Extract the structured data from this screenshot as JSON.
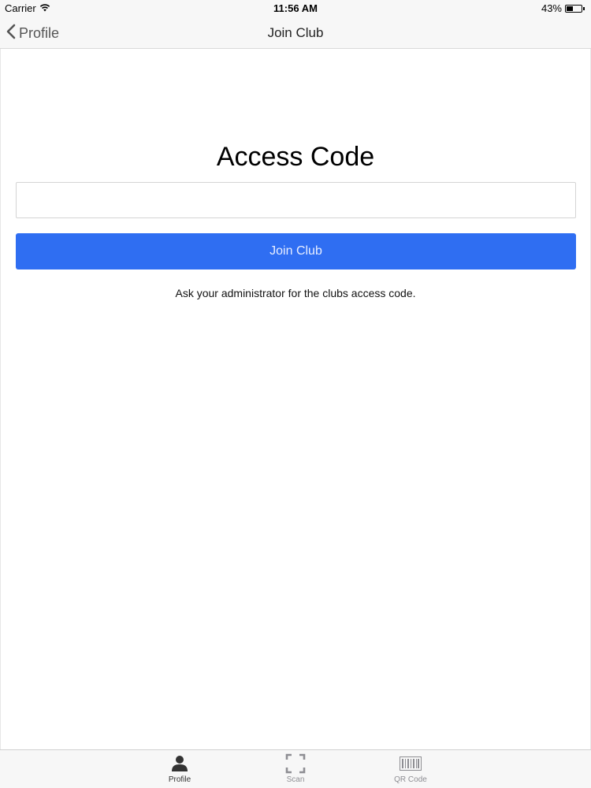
{
  "status_bar": {
    "carrier": "Carrier",
    "time": "11:56 AM",
    "battery_percent_label": "43%",
    "battery_level": 0.43
  },
  "nav": {
    "back_label": "Profile",
    "title": "Join Club"
  },
  "form": {
    "heading": "Access Code",
    "access_code_value": "",
    "access_code_placeholder": "",
    "join_button_label": "Join Club",
    "hint": "Ask your administrator for the clubs access code."
  },
  "tab_bar": {
    "active_color": "#333333",
    "inactive_color": "#8e8e93",
    "items": [
      {
        "label": "Profile",
        "icon": "person-icon",
        "active": true
      },
      {
        "label": "Scan",
        "icon": "scan-frame-icon",
        "active": false
      },
      {
        "label": "QR Code",
        "icon": "barcode-icon",
        "active": false
      }
    ]
  },
  "colors": {
    "accent": "#2f6ef2",
    "bar_background": "#f7f7f7"
  }
}
